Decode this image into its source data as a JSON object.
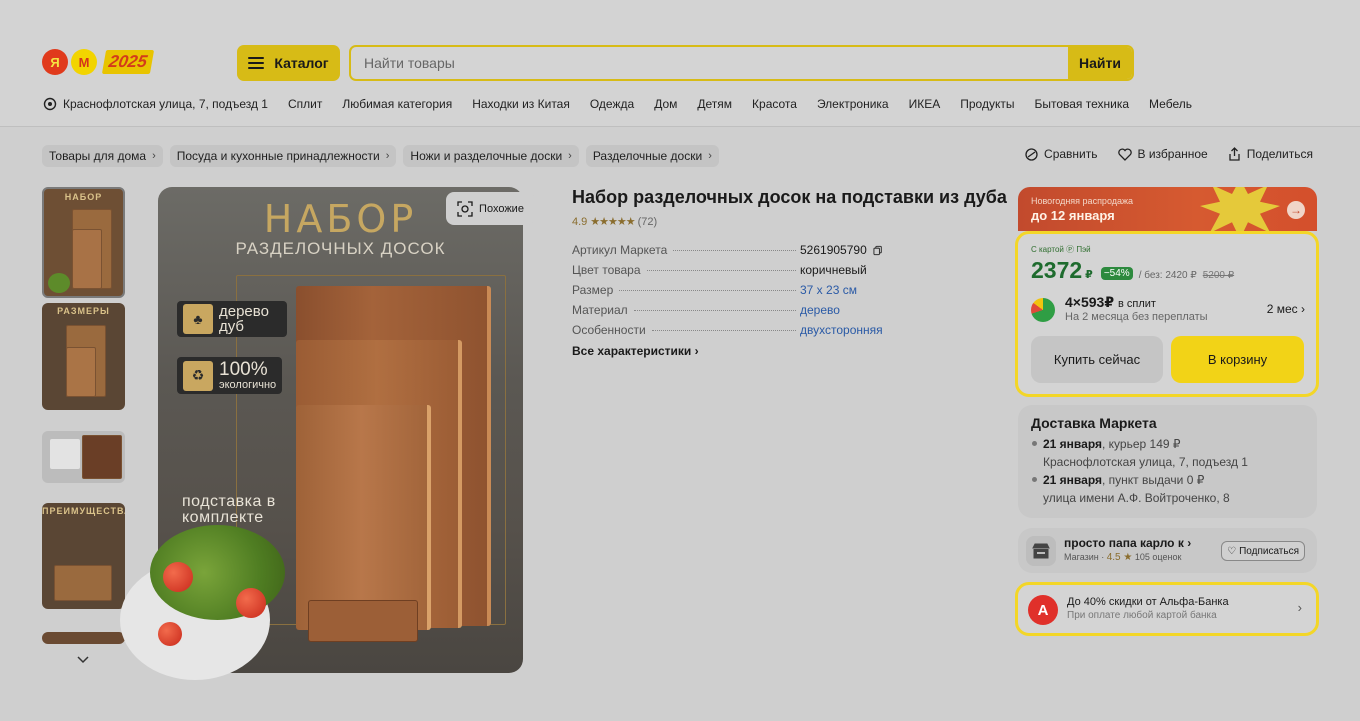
{
  "header": {
    "logo_ya": "Я",
    "logo_m": "М",
    "logo_sale": "2025",
    "catalog_label": "Каталог",
    "search_placeholder": "Найти товары",
    "search_button": "Найти"
  },
  "nav": {
    "address": "Краснофлотская улица, 7, подъезд 1",
    "items": [
      "Сплит",
      "Любимая категория",
      "Находки из Китая",
      "Одежда",
      "Дом",
      "Детям",
      "Красота",
      "Электроника",
      "ИКЕА",
      "Продукты",
      "Бытовая техника",
      "Мебель"
    ]
  },
  "breadcrumbs": [
    "Товары для дома",
    "Посуда и кухонные принадлежности",
    "Ножи и разделочные доски",
    "Разделочные доски"
  ],
  "actions": {
    "compare": "Сравнить",
    "favorite": "В избранное",
    "share": "Поделиться"
  },
  "gallery": {
    "thumb_labels": [
      "НАБОР",
      "РАЗМЕРЫ",
      "",
      "ПРЕИМУЩЕСТВА",
      ""
    ],
    "similar_label": "Похожие",
    "photo_title": "НАБОР",
    "photo_subtitle": "РАЗДЕЛОЧНЫХ ДОСОК",
    "badge_wood": "дерево дуб",
    "badge_eco_pct": "100%",
    "badge_eco": "экологично",
    "photo_caption": "подставка в комплекте"
  },
  "product": {
    "title": "Набор разделочных досок на подставки из дуба",
    "rating": "4.9",
    "stars": "★★★★★",
    "reviews": "(72)",
    "specs": [
      {
        "key": "Артикул Маркета",
        "value": "5261905790"
      },
      {
        "key": "Цвет товара",
        "value": "коричневый"
      },
      {
        "key": "Размер",
        "value": "37 x 23 см"
      },
      {
        "key": "Материал",
        "value": "дерево"
      },
      {
        "key": "Особенности",
        "value": "двухсторонняя"
      }
    ],
    "all_specs_link": "Все характеристики"
  },
  "promo": {
    "line1": "Новогодняя распродажа",
    "line2": "до 12 января"
  },
  "price": {
    "card_label": "С картой Ⓟ Пэй",
    "value": "2372",
    "currency": "₽",
    "discount": "−54%",
    "without_label": "/ без: 2420 ₽",
    "old_price": "5200 ₽",
    "split_amount": "4×593",
    "split_currency": "₽",
    "split_label": "в сплит",
    "split_sub": "На 2 месяца без переплаты",
    "split_term": "2 мес",
    "buy_now": "Купить сейчас",
    "add_to_cart": "В корзину"
  },
  "delivery": {
    "title": "Доставка Маркета",
    "options": [
      {
        "date": "21 января",
        "rest": ", курьер  149 ₽",
        "address": "Краснофлотская улица, 7, подъезд 1"
      },
      {
        "date": "21 января",
        "rest": ", пункт выдачи  0 ₽",
        "address": "улица имени А.Ф. Войтроченко, 8"
      }
    ]
  },
  "shop": {
    "name": "просто папа карло к",
    "type": "Магазин · ",
    "rating": "4.5 ★",
    "reviews": "105 оценок",
    "subscribe": "Подписаться"
  },
  "alfa": {
    "title": "До 40% скидки от Альфа-Банка",
    "subtitle": "При оплате любой картой банка"
  },
  "colors": {
    "accent_yellow": "#f2d317",
    "price_green": "#1e6b2e",
    "promo_red": "#c24a2d"
  }
}
